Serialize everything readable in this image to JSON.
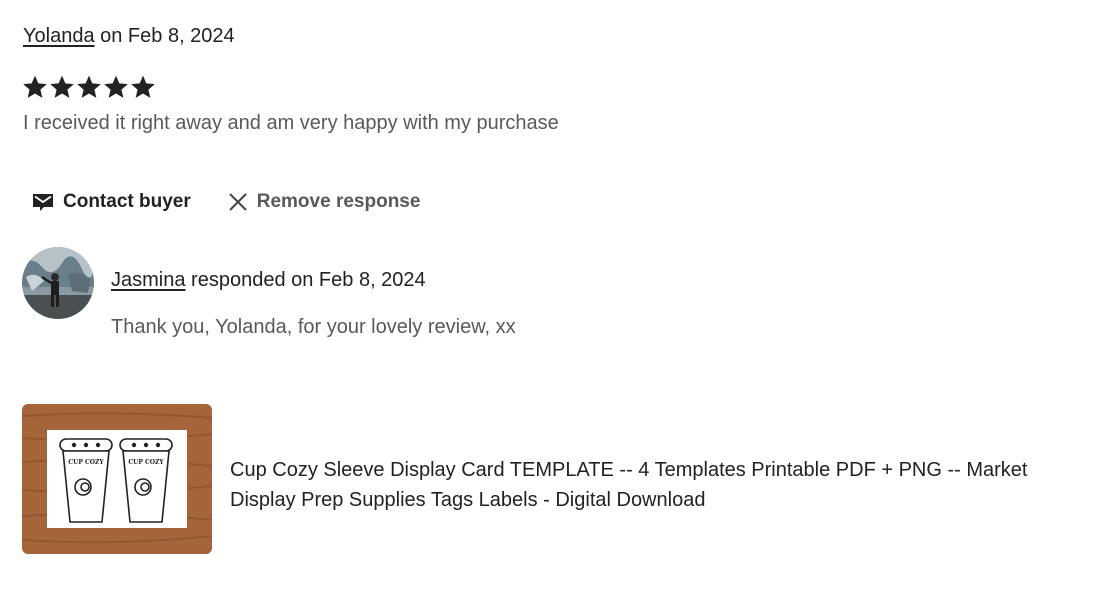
{
  "review": {
    "reviewer_name": "Yolanda",
    "date_text": " on Feb 8, 2024",
    "rating": 5,
    "rating_max": 5,
    "text": "I received it right away and am very happy with my purchase"
  },
  "actions": {
    "contact_label": "Contact buyer",
    "contact_icon": "envelope-icon",
    "remove_label": "Remove response",
    "remove_icon": "close-icon"
  },
  "response": {
    "responder_name": "Jasmina",
    "date_text": " responded on Feb 8, 2024",
    "text": "Thank you, Yolanda, for your lovely review, xx"
  },
  "product": {
    "title": "Cup Cozy Sleeve Display Card TEMPLATE -- 4 Templates Printable PDF + PNG -- Market Display Prep Supplies Tags Labels - Digital Download",
    "thumb_label": "CUP COZY"
  },
  "colors": {
    "text_primary": "#222222",
    "text_secondary": "#595959",
    "wood": "#a5643a"
  }
}
